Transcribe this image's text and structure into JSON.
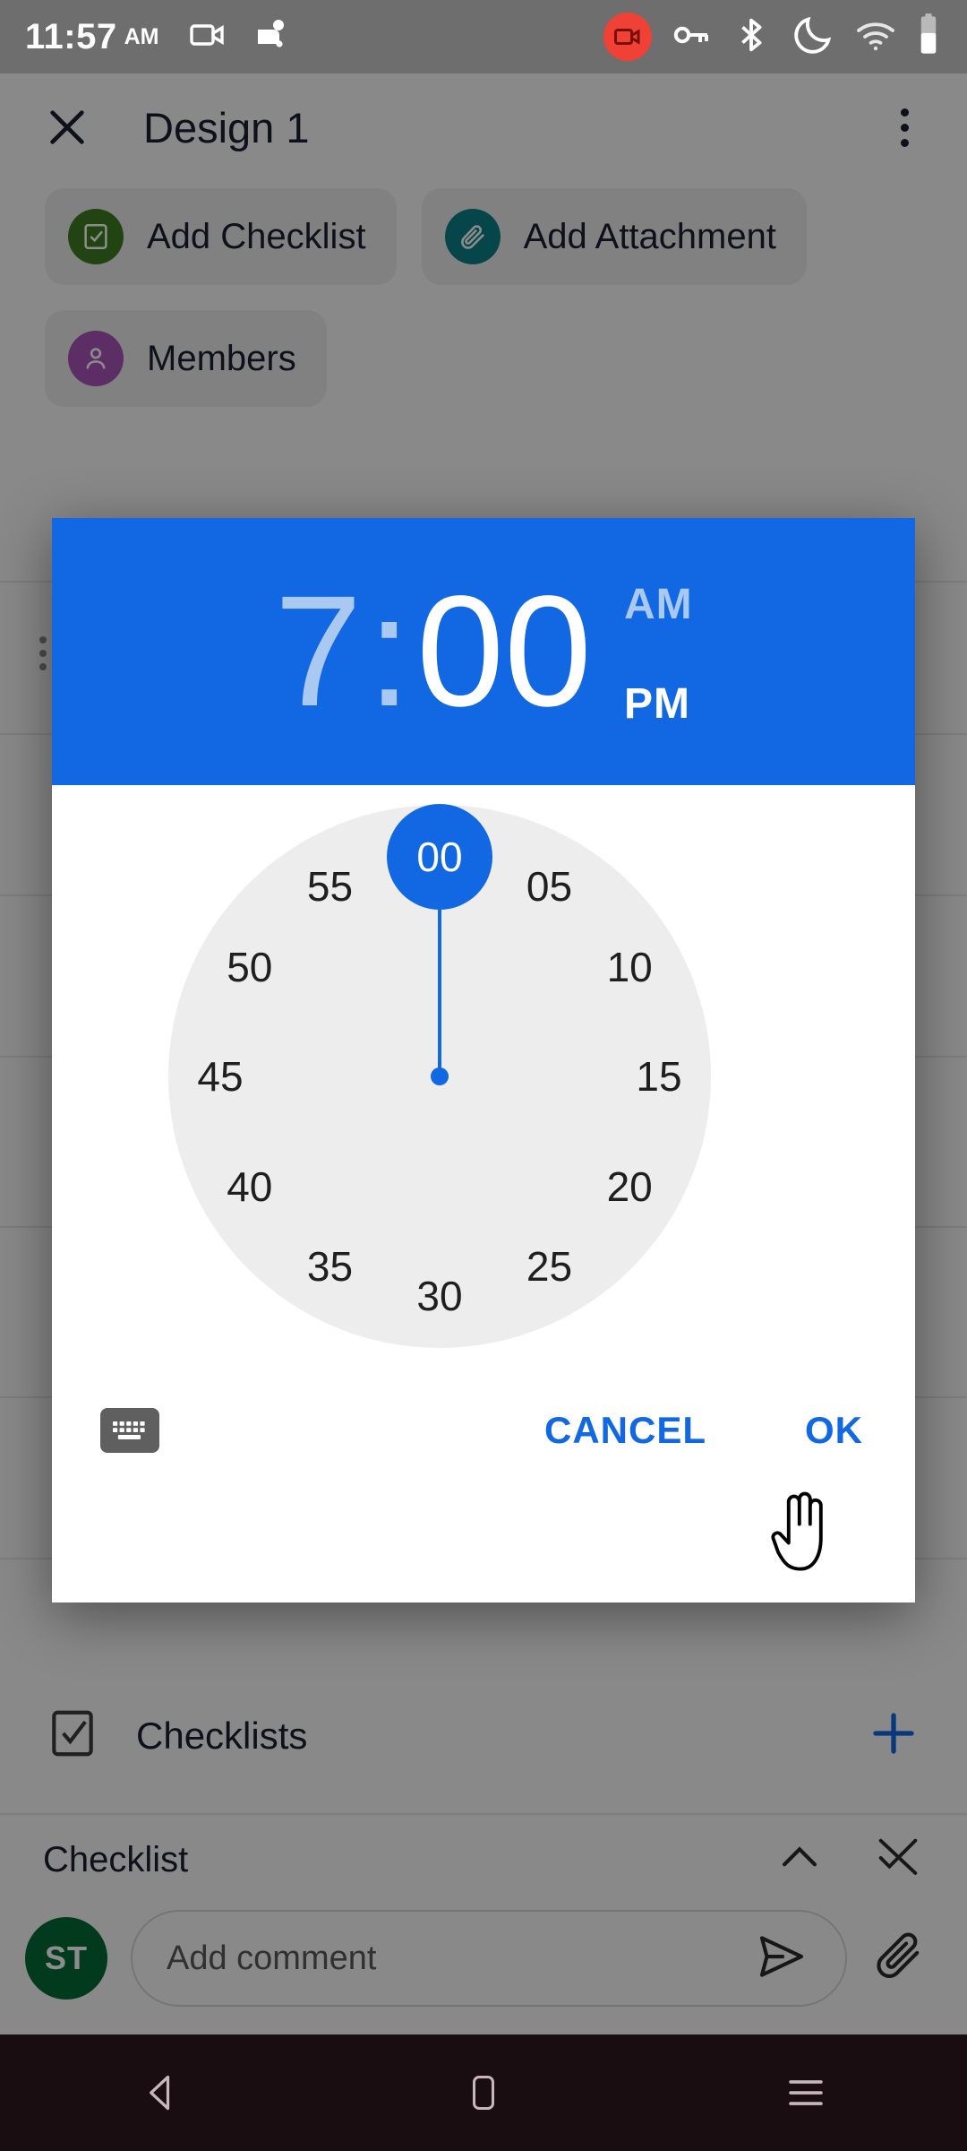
{
  "status_bar": {
    "time": "11:57",
    "time_suffix": "AM",
    "left_icons": [
      "video-camera-icon",
      "android-robot-icon"
    ],
    "right_icons": [
      "screen-record-badge-icon",
      "key-icon",
      "bluetooth-icon",
      "dnd-moon-icon",
      "wifi-icon",
      "battery-icon"
    ]
  },
  "toolbar": {
    "close_icon": "close-x-icon",
    "title": "Design 1",
    "overflow_icon": "more-vertical-icon"
  },
  "chips": [
    {
      "label": "Add Checklist",
      "icon": "checklist-icon",
      "color": "#3f7b22"
    },
    {
      "label": "Add Attachment",
      "icon": "paperclip-icon",
      "color": "#0b7f87"
    },
    {
      "label": "Members",
      "icon": "person-icon",
      "color": "#a855b8"
    }
  ],
  "checklists_row": {
    "icon": "checkbox-outline-icon",
    "label": "Checklists",
    "add_icon": "plus-icon",
    "add_color": "#1268e3"
  },
  "checklist_section": {
    "title": "Checklist",
    "collapse_icon": "chevron-up-icon",
    "hide_checked_icon": "hide-checked-items-icon",
    "avatar_initials": "ST",
    "avatar_color": "#046A38",
    "comment_placeholder": "Add comment",
    "send_icon": "send-icon",
    "attach_icon": "paperclip-icon"
  },
  "time_picker": {
    "hour": "7",
    "separator": ":",
    "minute": "00",
    "am_label": "AM",
    "pm_label": "PM",
    "active_field": "minute",
    "active_period": "PM",
    "header_color": "#1268e3",
    "inactive_color": "#a9c8f2",
    "clock_mode": "minutes",
    "selected_value": "00",
    "clock_face_color": "#ededed",
    "ticks": [
      "00",
      "05",
      "10",
      "15",
      "20",
      "25",
      "30",
      "35",
      "40",
      "45",
      "50",
      "55"
    ],
    "keyboard_toggle_icon": "keyboard-icon",
    "cancel_label": "CANCEL",
    "ok_label": "OK",
    "action_color": "#1268e3"
  },
  "nav_bar": {
    "back_icon": "nav-back-icon",
    "home_icon": "nav-home-icon",
    "recents_icon": "nav-recents-icon"
  },
  "cursor": {
    "icon": "pointing-hand-cursor"
  }
}
